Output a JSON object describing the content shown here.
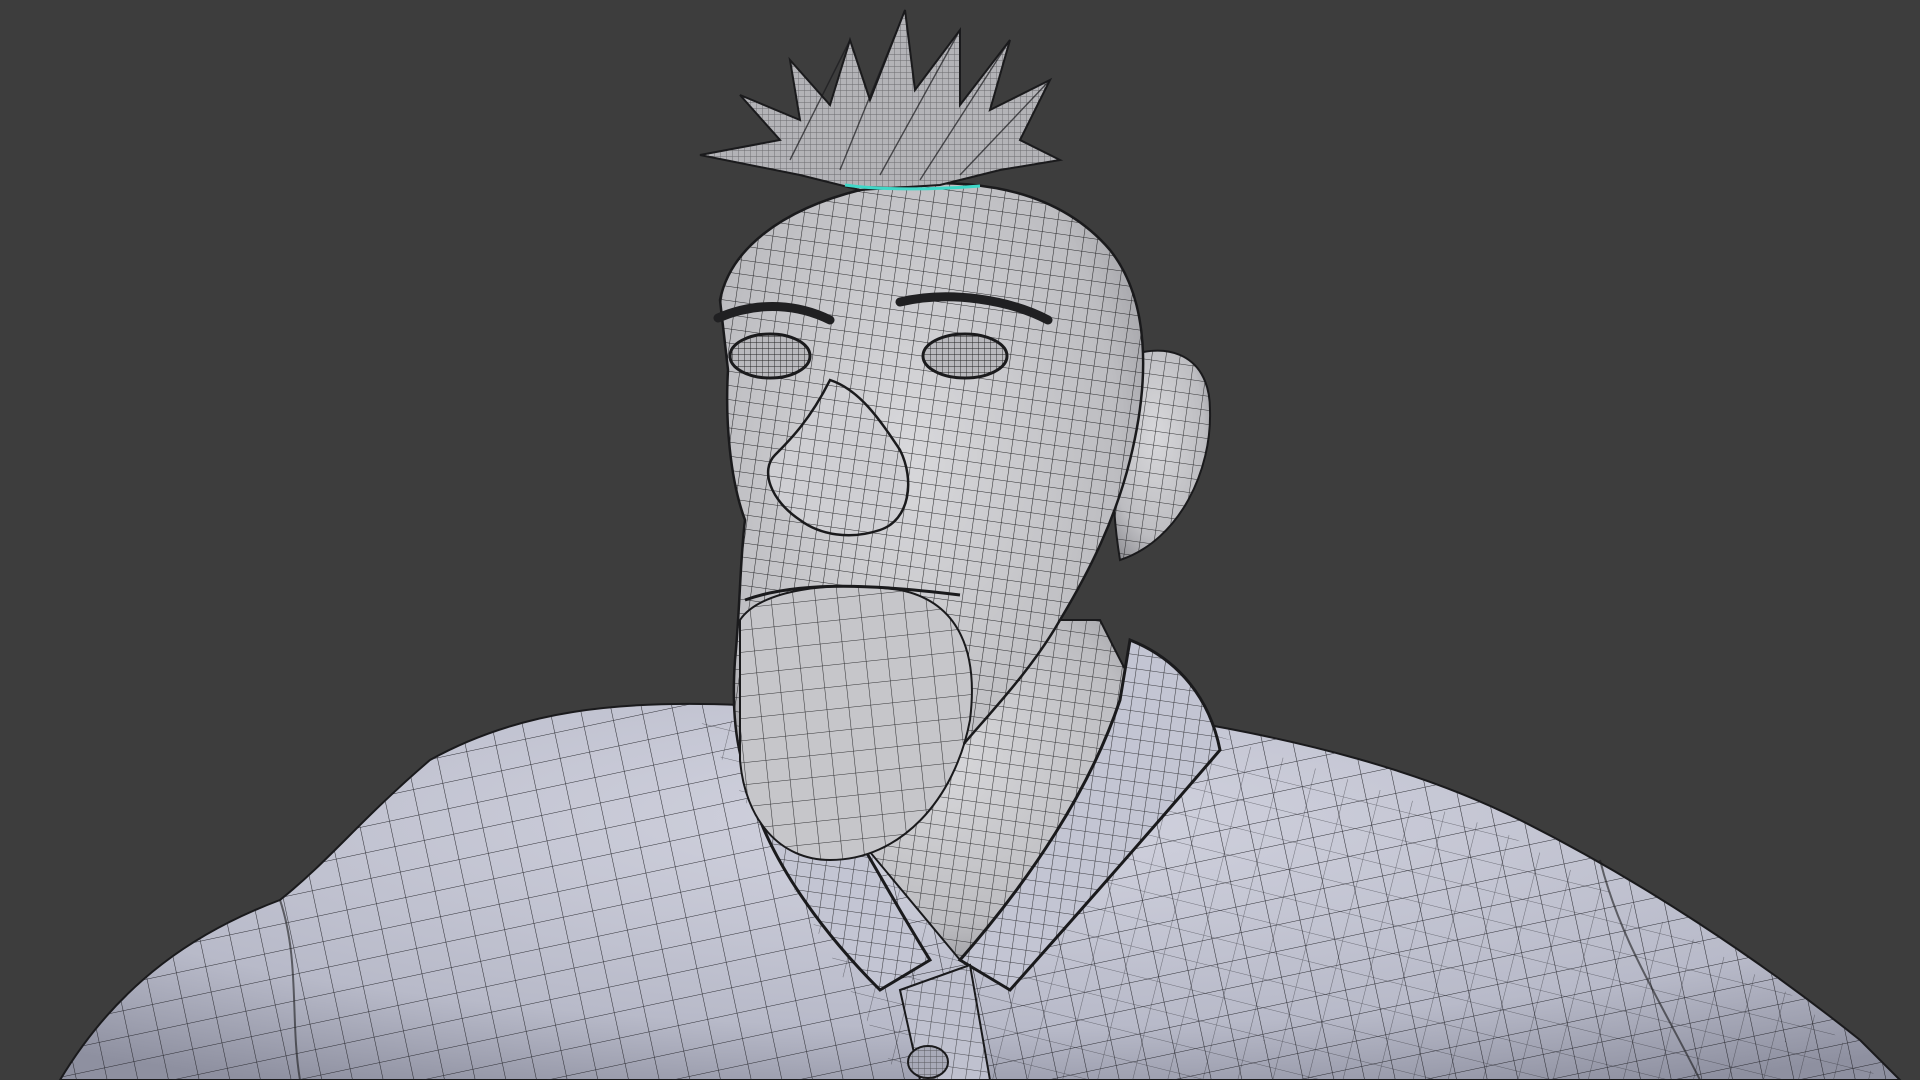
{
  "viewport": {
    "background_color": "#3d3d3d",
    "view_mode": "wireframe-overlay",
    "subject": "character-mesh"
  },
  "model": {
    "skin_color": "#c9c9cc",
    "shirt_color": "#c2c4d2",
    "wire_color": "#1a1a1c",
    "selection_highlight": "#3fd7c7",
    "parts": [
      "hair-spikes",
      "head",
      "eyes",
      "nose",
      "ear",
      "neck",
      "shirt",
      "collar",
      "button"
    ]
  }
}
